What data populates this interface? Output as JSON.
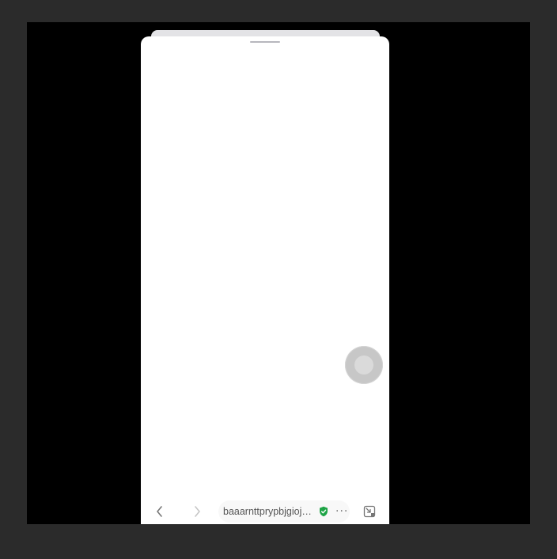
{
  "browser": {
    "url_text": "baaarnttprypbjgioj6...",
    "more_label": "···"
  },
  "icons": {
    "back": "chevron-left-icon",
    "forward": "chevron-right-icon",
    "verified": "verified-shield-icon",
    "more": "more-dots-icon",
    "expand": "expand-window-icon",
    "handle": "drag-handle-icon",
    "float": "floating-assistant-icon"
  },
  "colors": {
    "page_bg": "#2b2b2b",
    "stage_bg": "#000000",
    "sheet_bg": "#ffffff",
    "verified_green": "#1ea446",
    "float_button": "#c7c7c7"
  }
}
